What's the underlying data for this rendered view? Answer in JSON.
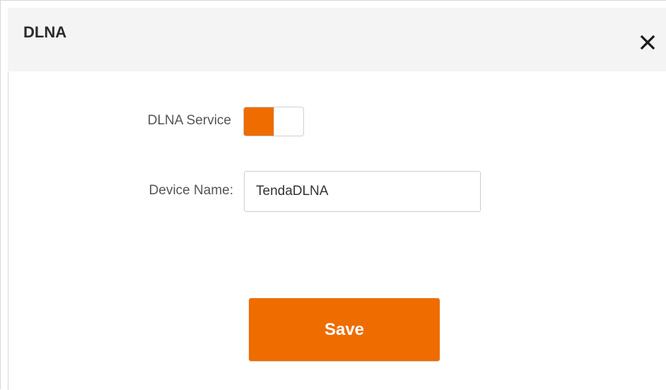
{
  "dialog": {
    "title": "DLNA",
    "close_icon": "close-icon"
  },
  "form": {
    "service_label": "DLNA Service",
    "service_enabled": true,
    "device_name_label": "Device Name:",
    "device_name_value": "TendaDLNA"
  },
  "actions": {
    "save_label": "Save"
  },
  "colors": {
    "accent": "#ef6c00",
    "header_bg": "#f4f4f4",
    "label_text": "#555555",
    "title_text": "#2b2b2b"
  }
}
